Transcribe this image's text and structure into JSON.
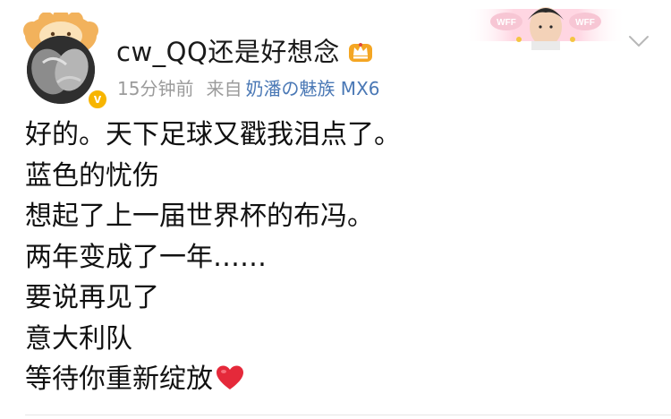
{
  "post": {
    "username": "cw_QQ还是好想念",
    "time": "15分钟前",
    "source_prefix": "来自",
    "source_device": "奶潘の魅族 MX6",
    "lines": [
      "好的。天下足球又戳我泪点了。",
      "蓝色的忧伤",
      "想起了上一届世界杯的布冯。",
      "两年变成了一年……",
      "要说再见了",
      "意大利队",
      "等待你重新绽放"
    ],
    "verified_badge_glyph": "v",
    "decoration_label": "WFF"
  },
  "icons": {
    "member_crown": "crown-icon",
    "verified": "verified-icon",
    "dropdown": "chevron-down-icon",
    "heart": "heart-icon"
  },
  "colors": {
    "text": "#111111",
    "meta_gray": "#9b9b9b",
    "link_blue": "#4a78b5",
    "badge_gold": "#f7b500",
    "heart_red": "#e5293a"
  }
}
